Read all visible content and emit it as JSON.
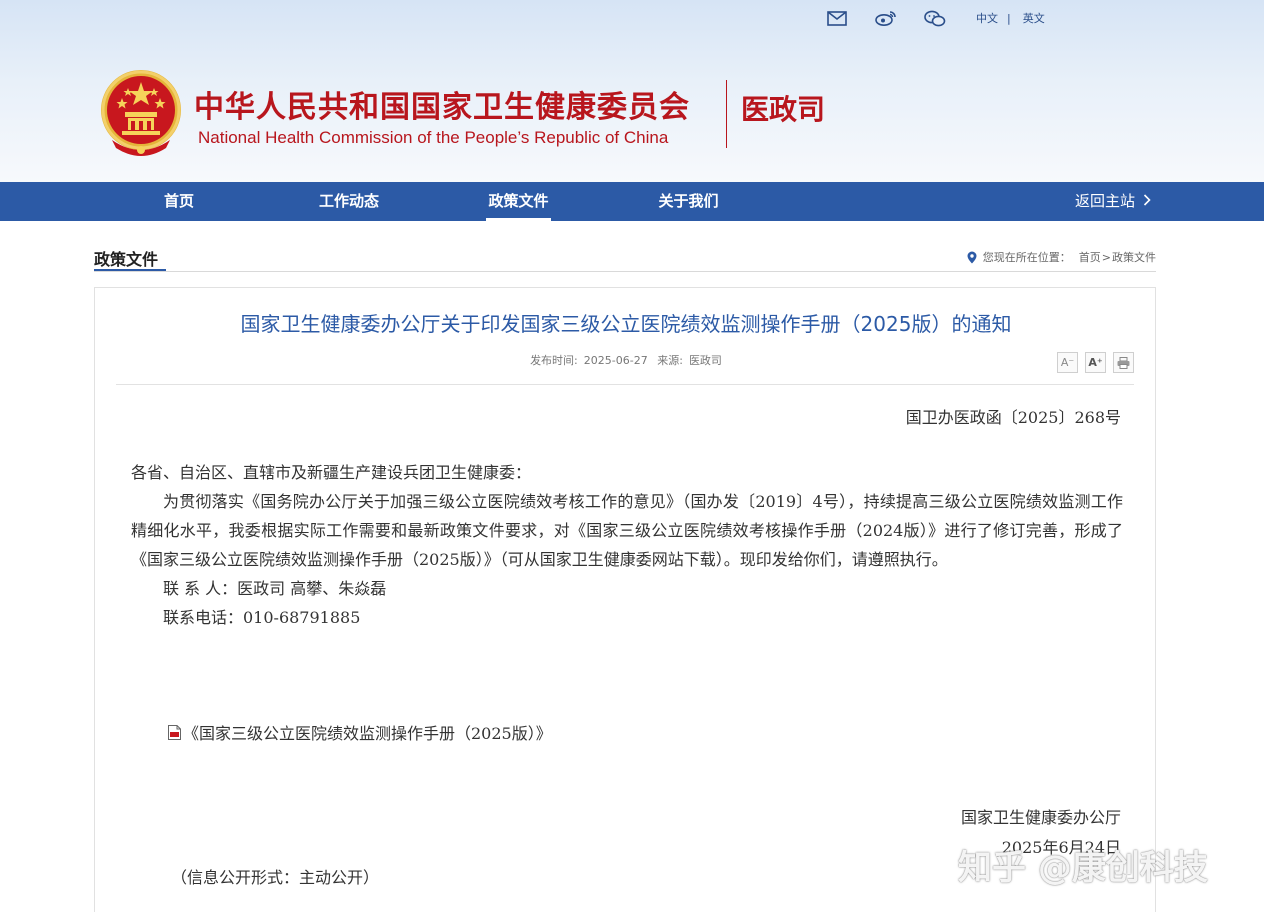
{
  "header": {
    "top_links": {
      "lang_cn": "中文",
      "lang_sep": "|",
      "lang_en": "英文"
    },
    "icons": [
      "mail-icon",
      "weibo-icon",
      "wechat-icon"
    ],
    "org_name_cn": "中华人民共和国国家卫生健康委员会",
    "org_name_en": "National Health Commission of the People’s  Republic of China",
    "department": "医政司"
  },
  "nav": {
    "items": [
      {
        "label": "首页"
      },
      {
        "label": "工作动态"
      },
      {
        "label": "政策文件"
      },
      {
        "label": "关于我们"
      }
    ],
    "active": "政策文件",
    "back_label": "返回主站"
  },
  "column": {
    "title": "政策文件",
    "breadcrumb": {
      "prefix": "您现在所在位置：",
      "home": "首页",
      "sep": ">",
      "current": "政策文件"
    }
  },
  "article": {
    "title": "国家卫生健康委办公厅关于印发国家三级公立医院绩效监测操作手册（2025版）的通知",
    "meta": {
      "date_label": "发布时间:",
      "date": "2025-06-27",
      "source_label": "来源:",
      "source": "医政司"
    },
    "tools": {
      "font_smaller": "A⁻",
      "font_larger": "A⁺"
    },
    "doc_number": "国卫办医政函〔2025〕268号",
    "salutation": "各省、自治区、直辖市及新疆生产建设兵团卫生健康委：",
    "body": "为贯彻落实《国务院办公厅关于加强三级公立医院绩效考核工作的意见》（国办发〔2019〕4号），持续提高三级公立医院绩效监测工作精细化水平，我委根据实际工作需要和最新政策文件要求，对《国家三级公立医院绩效考核操作手册（2024版）》进行了修订完善，形成了《国家三级公立医院绩效监测操作手册（2025版）》（可从国家卫生健康委网站下载）。现印发给你们，请遵照执行。",
    "contact_person": "联 系 人：医政司 高攀、朱焱磊",
    "contact_phone": "联系电话：010-68791885",
    "attachment": "《国家三级公立医院绩效监测操作手册（2025版）》",
    "sign_org": "国家卫生健康委办公厅",
    "sign_date": "2025年6月24日",
    "disclosure": "（信息公开形式：主动公开）"
  },
  "watermark": "知乎 @康创科技",
  "colors": {
    "brand_red": "#b8161d",
    "nav_blue": "#2c5aa6"
  }
}
